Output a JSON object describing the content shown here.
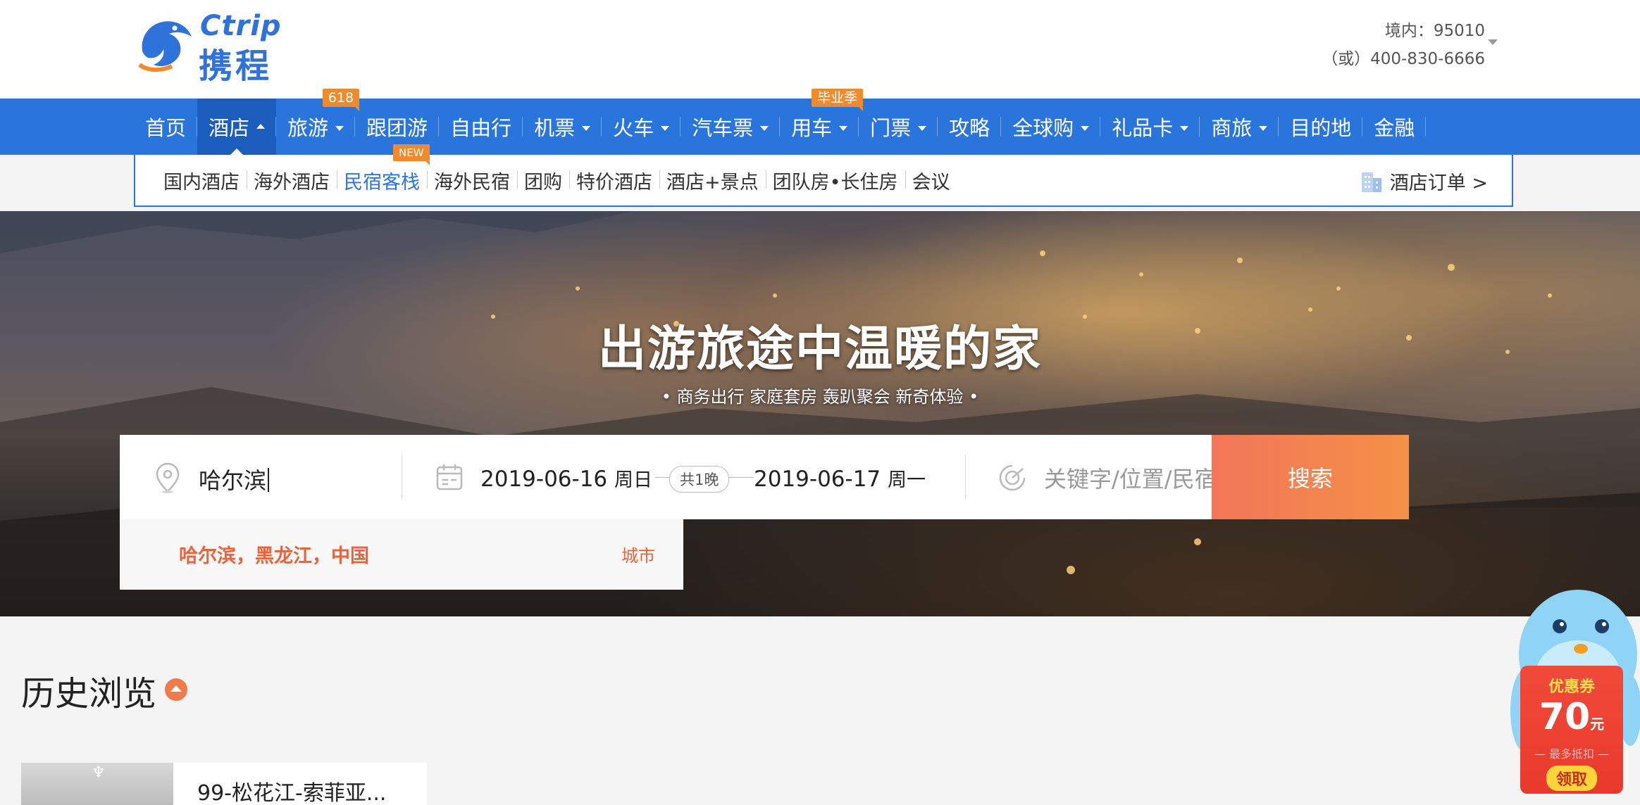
{
  "brand": {
    "logo_en": "Ctrip",
    "logo_cn": "携程"
  },
  "hotline": {
    "domestic": "境内：95010",
    "alt": "（或）400-830-6666"
  },
  "main_nav": [
    {
      "label": "首页",
      "dropdown": false
    },
    {
      "label": "酒店",
      "dropdown": true,
      "active": true
    },
    {
      "label": "旅游",
      "dropdown": true,
      "badge": "618"
    },
    {
      "label": "跟团游",
      "dropdown": false
    },
    {
      "label": "自由行",
      "dropdown": false
    },
    {
      "label": "机票",
      "dropdown": true
    },
    {
      "label": "火车",
      "dropdown": true
    },
    {
      "label": "汽车票",
      "dropdown": true
    },
    {
      "label": "用车",
      "dropdown": true,
      "badge": "毕业季"
    },
    {
      "label": "门票",
      "dropdown": true
    },
    {
      "label": "攻略",
      "dropdown": false
    },
    {
      "label": "全球购",
      "dropdown": true
    },
    {
      "label": "礼品卡",
      "dropdown": true
    },
    {
      "label": "商旅",
      "dropdown": true
    },
    {
      "label": "目的地",
      "dropdown": false
    },
    {
      "label": "金融",
      "dropdown": false
    }
  ],
  "sub_nav": {
    "items": [
      "国内酒店",
      "海外酒店",
      "民宿客栈",
      "海外民宿",
      "团购",
      "特价酒店",
      "酒店+景点",
      "团队房•长住房",
      "会议"
    ],
    "selected": "民宿客栈",
    "new_badge": "NEW",
    "orders_label": "酒店订单 >"
  },
  "hero": {
    "title": "出游旅途中温暖的家",
    "subtitle": "• 商务出行 家庭套房 轰趴聚会 新奇体验 •"
  },
  "search": {
    "city_value": "哈尔滨",
    "checkin_date": "2019-06-16",
    "checkin_weekday": "周日",
    "nights": "共1晚",
    "checkout_date": "2019-06-17",
    "checkout_weekday": "周一",
    "keyword_placeholder": "关键字/位置/民宿名",
    "button_label": "搜索"
  },
  "suggestion": {
    "name": "哈尔滨，黑龙江，中国",
    "type": "城市"
  },
  "history": {
    "title": "历史浏览",
    "item_name": "99-松花江-索菲亚..."
  },
  "coupon": {
    "label": "优惠券",
    "amount": "70",
    "unit": "元",
    "note": "— 最多抵扣 —",
    "button": "领取"
  },
  "colors": {
    "nav_blue": "#2a75dc",
    "accent_orange": "#f27659",
    "suggest_text": "#e8643c"
  }
}
